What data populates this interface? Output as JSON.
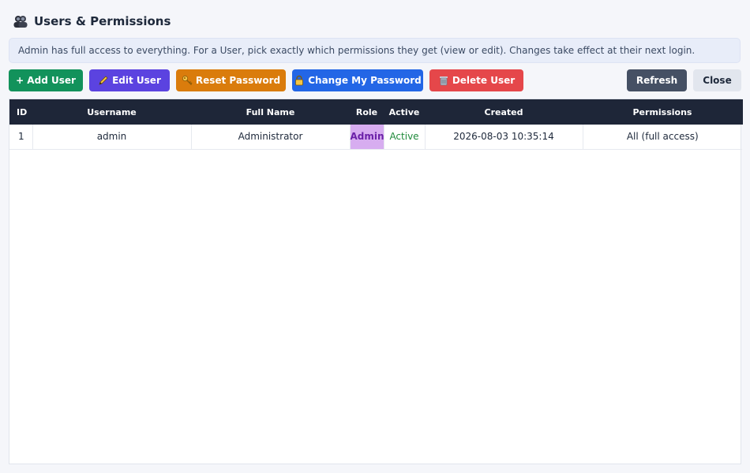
{
  "header": {
    "title": "Users & Permissions",
    "icon": "users-icon"
  },
  "info": {
    "text": "Admin has full access to everything. For a User, pick exactly which permissions they get (view or edit). Changes take effect at their next login."
  },
  "toolbar": {
    "add_label": "+ Add User",
    "edit_label": "Edit User",
    "reset_label": "Reset Password",
    "change_label": "Change My Password",
    "delete_label": "Delete User",
    "refresh_label": "Refresh",
    "close_label": "Close"
  },
  "table": {
    "columns": [
      "ID",
      "Username",
      "Full Name",
      "Role",
      "Active",
      "Created",
      "Permissions"
    ],
    "rows": [
      {
        "id": "1",
        "username": "admin",
        "full_name": "Administrator",
        "role": "Admin",
        "active": "Active",
        "created": "2026-08-03 10:35:14",
        "permissions": "All (full access)"
      }
    ]
  },
  "colors": {
    "add": "#12925b",
    "edit": "#5b43e0",
    "reset": "#da7c0c",
    "change": "#2366e6",
    "delete": "#e5474a",
    "refresh": "#455064",
    "header_bg": "#1e2638",
    "role_admin_bg": "#d7adf0"
  }
}
